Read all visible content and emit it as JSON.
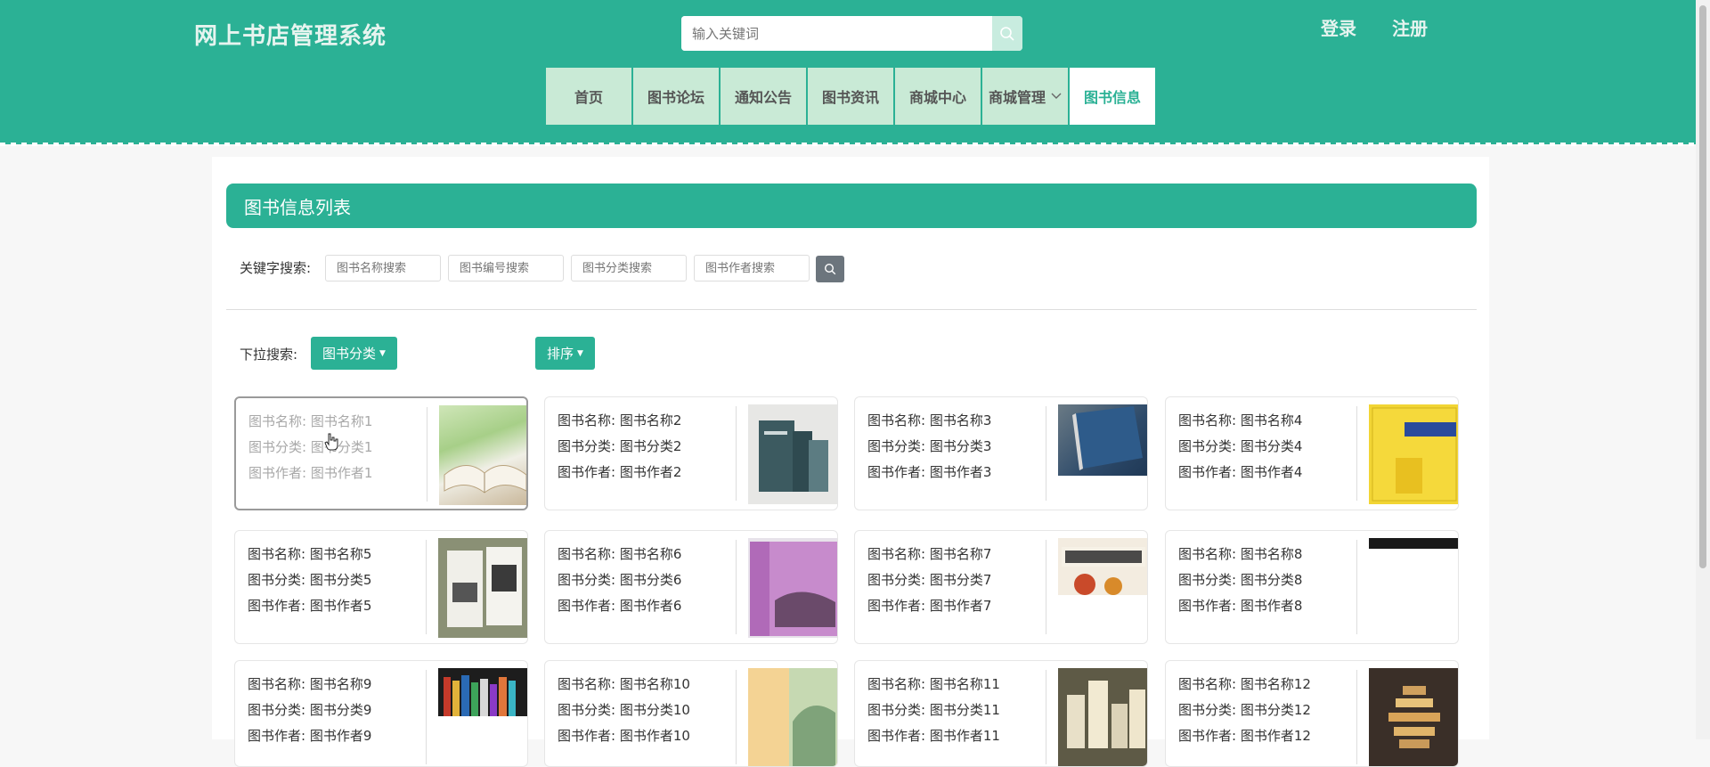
{
  "header": {
    "brand": "网上书店管理系统",
    "search_placeholder": "输入关键词",
    "login": "登录",
    "register": "注册",
    "nav": [
      {
        "label": "首页"
      },
      {
        "label": "图书论坛"
      },
      {
        "label": "通知公告"
      },
      {
        "label": "图书资讯"
      },
      {
        "label": "商城中心"
      },
      {
        "label": "商城管理"
      },
      {
        "label": "图书信息"
      }
    ]
  },
  "main": {
    "title": "图书信息列表",
    "keyword_label": "关键字搜索:",
    "placeholders": [
      "图书名称搜索",
      "图书编号搜索",
      "图书分类搜索",
      "图书作者搜索"
    ],
    "dropdown_label": "下拉搜索:",
    "category_button": "图书分类",
    "sort_button": "排序",
    "books": [
      {
        "name": "图书名称: 图书名称1",
        "category": "图书分类: 图书分类1",
        "author": "图书作者: 图书作者1"
      },
      {
        "name": "图书名称: 图书名称2",
        "category": "图书分类: 图书分类2",
        "author": "图书作者: 图书作者2"
      },
      {
        "name": "图书名称: 图书名称3",
        "category": "图书分类: 图书分类3",
        "author": "图书作者: 图书作者3"
      },
      {
        "name": "图书名称: 图书名称4",
        "category": "图书分类: 图书分类4",
        "author": "图书作者: 图书作者4"
      },
      {
        "name": "图书名称: 图书名称5",
        "category": "图书分类: 图书分类5",
        "author": "图书作者: 图书作者5"
      },
      {
        "name": "图书名称: 图书名称6",
        "category": "图书分类: 图书分类6",
        "author": "图书作者: 图书作者6"
      },
      {
        "name": "图书名称: 图书名称7",
        "category": "图书分类: 图书分类7",
        "author": "图书作者: 图书作者7"
      },
      {
        "name": "图书名称: 图书名称8",
        "category": "图书分类: 图书分类8",
        "author": "图书作者: 图书作者8"
      },
      {
        "name": "图书名称: 图书名称9",
        "category": "图书分类: 图书分类9",
        "author": "图书作者: 图书作者9"
      },
      {
        "name": "图书名称: 图书名称10",
        "category": "图书分类: 图书分类10",
        "author": "图书作者: 图书作者10"
      },
      {
        "name": "图书名称: 图书名称11",
        "category": "图书分类: 图书分类11",
        "author": "图书作者: 图书作者11"
      },
      {
        "name": "图书名称: 图书名称12",
        "category": "图书分类: 图书分类12",
        "author": "图书作者: 图书作者12"
      }
    ]
  },
  "colors": {
    "accent": "#2bb195",
    "nav_bg": "#c9ead6",
    "search_btn": "#6c757d"
  }
}
